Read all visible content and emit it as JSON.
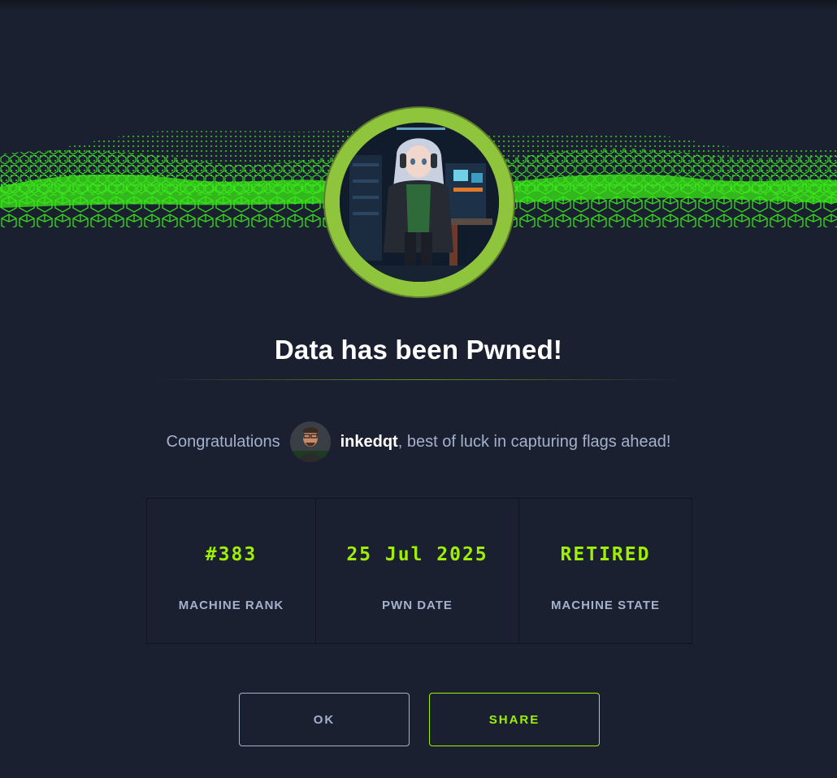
{
  "dialog": {
    "title": "Data has been Pwned!",
    "congrats_prefix": "Congratulations",
    "username": "inkedqt",
    "congrats_suffix": ", best of luck in capturing flags ahead!"
  },
  "stats": [
    {
      "value": "#383",
      "label": "MACHINE RANK"
    },
    {
      "value": "25 Jul 2025",
      "label": "PWN DATE"
    },
    {
      "value": "RETIRED",
      "label": "MACHINE STATE"
    }
  ],
  "buttons": {
    "ok_label": "OK",
    "share_label": "SHARE"
  },
  "colors": {
    "background": "#1a2030",
    "accent": "#9fef00",
    "ring": "#8fc53c",
    "muted_text": "#a4b1cd"
  },
  "icons": {
    "machine_avatar": "machine-avatar-icon",
    "user_avatar": "user-avatar-icon"
  }
}
